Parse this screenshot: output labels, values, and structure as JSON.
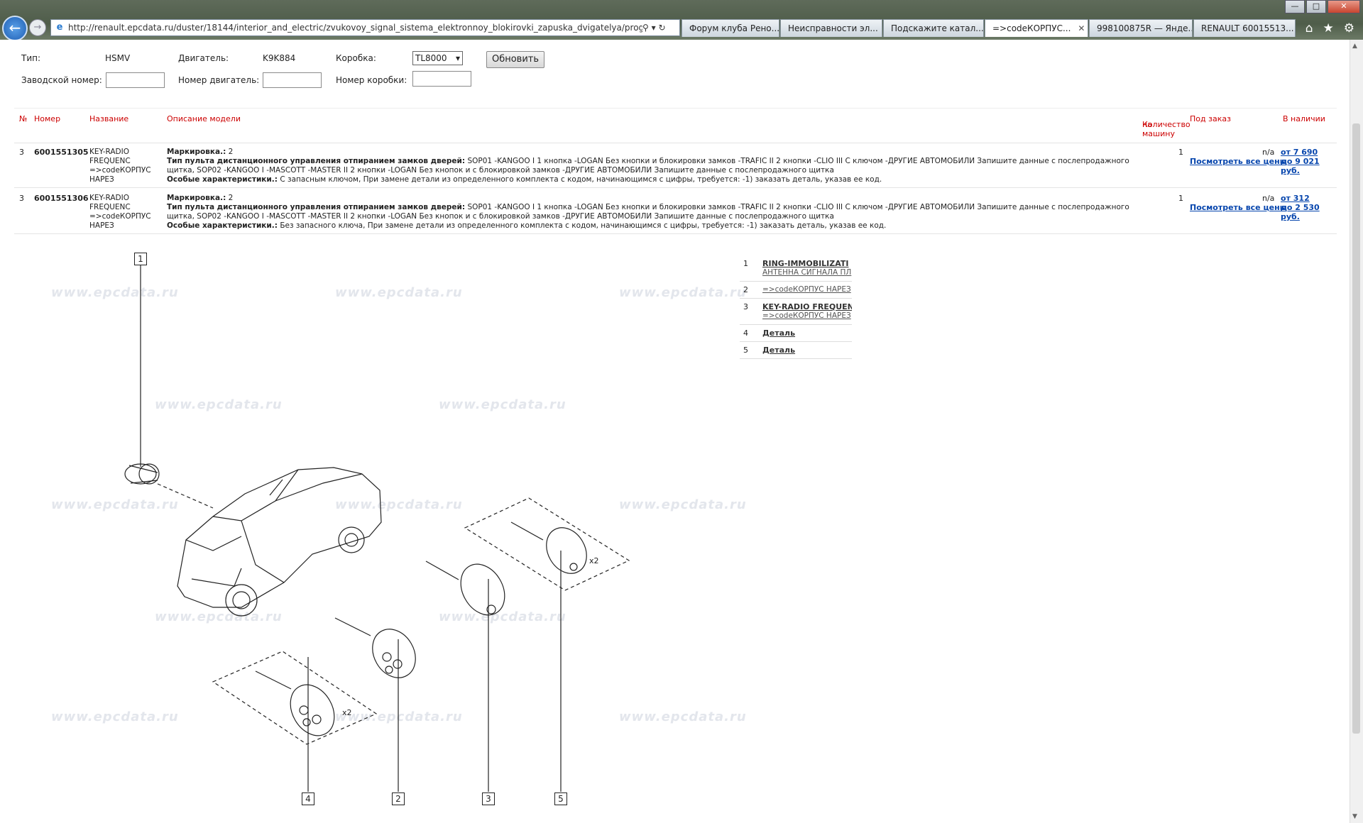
{
  "browser": {
    "url": "http://renault.epcdata.ru/duster/18144/interior_and_electric/zvukovoy_signal_sistema_elektronnoy_blokirovki_zapuska_dvigatelya/programmnaya_blokir",
    "tabs": [
      {
        "label": "Форум клуба Рено...",
        "active": false
      },
      {
        "label": "Неисправности эл...",
        "active": false
      },
      {
        "label": "Подскажите катал...",
        "active": false
      },
      {
        "label": "=>codeКОРПУС...",
        "active": true
      },
      {
        "label": "998100875R — Янде...",
        "active": false
      },
      {
        "label": "RENAULT 60015513...",
        "active": false
      }
    ],
    "window_controls": {
      "minimize": "—",
      "maximize": "□",
      "close": "✕"
    }
  },
  "form": {
    "type_label": "Тип:",
    "type_value": "HSMV",
    "engine_label": "Двигатель:",
    "engine_value": "K9K884",
    "gearbox_label": "Коробка:",
    "gearbox_value": "TL8000",
    "update_button": "Обновить",
    "vin_label": "Заводской номер:",
    "engine_no_label": "Номер двигатель:",
    "gearbox_no_label": "Номер коробки:"
  },
  "table": {
    "headers": {
      "no": "№",
      "number": "Номер",
      "name": "Название",
      "desc": "Описание модели",
      "qty_line1": "Количество",
      "qty_line2": "на машину",
      "order": "Под заказ",
      "stock": "В наличии"
    },
    "rows": [
      {
        "pos": "3",
        "number": "6001551305",
        "name": "KEY-RADIO FREQUENC =>codeКОРПУС НАРЕЗ",
        "mark_label": "Маркировка.:",
        "mark_value": "2",
        "remote_label": "Тип пульта дистанционного управления отпиранием замков дверей:",
        "remote_value": "SOP01 -KANGOO I 1 кнопка -LOGAN Без кнопки и блокировки замков -TRAFIC II 2 кнопки -CLIO III С ключом -ДРУГИЕ АВТОМОБИЛИ Запишите данные с послепродажного щитка, SOP02 -KANGOO I -MASCOTT -MASTER II 2 кнопки -LOGAN Без кнопок и с блокировкой замков -ДРУГИЕ АВТОМОБИЛИ Запишите данные с послепродажного щитка",
        "special_label": "Особые характеристики.:",
        "special_value": "С запасным ключом, При замене детали из определенного комплекта с кодом, начинающимся с цифры, требуется: -1) заказать деталь, указав ее код.",
        "qty": "1",
        "order_na": "n/a",
        "order_link": "Посмотреть все цены",
        "stock_from": "от 7 690",
        "stock_to": "до 9 021 руб."
      },
      {
        "pos": "3",
        "number": "6001551306",
        "name": "KEY-RADIO FREQUENC =>codeКОРПУС НАРЕЗ",
        "mark_label": "Маркировка.:",
        "mark_value": "2",
        "remote_label": "Тип пульта дистанционного управления отпиранием замков дверей:",
        "remote_value": "SOP01 -KANGOO I 1 кнопка -LOGAN Без кнопки и блокировки замков -TRAFIC II 2 кнопки -CLIO III С ключом -ДРУГИЕ АВТОМОБИЛИ Запишите данные с послепродажного щитка, SOP02 -KANGOO I -MASCOTT -MASTER II 2 кнопки -LOGAN Без кнопок и с блокировкой замков -ДРУГИЕ АВТОМОБИЛИ Запишите данные с послепродажного щитка",
        "special_label": "Особые характеристики.:",
        "special_value": "Без запасного ключа, При замене детали из определенного комплекта с кодом, начинающимся с цифры, требуется: -1) заказать деталь, указав ее код.",
        "qty": "1",
        "order_na": "n/a",
        "order_link": "Посмотреть все цены",
        "stock_from": "от 312",
        "stock_to": "до 2 530 руб."
      }
    ]
  },
  "diagram": {
    "watermark": "www.epcdata.ru",
    "callouts": [
      "1",
      "2",
      "3",
      "4",
      "5"
    ],
    "multiplier": "x2"
  },
  "legend": [
    {
      "n": "1",
      "title": "RING-IMMOBILIZATI",
      "sub": "АНТЕННА СИГНАЛА ПЛ"
    },
    {
      "n": "2",
      "title": "",
      "sub": "=>codeКОРПУС НАРЕЗ"
    },
    {
      "n": "3",
      "title": "KEY-RADIO FREQUENC",
      "sub": "=>codeКОРПУС НАРЕЗ"
    },
    {
      "n": "4",
      "title": "Деталь",
      "sub": ""
    },
    {
      "n": "5",
      "title": "Деталь",
      "sub": ""
    }
  ]
}
